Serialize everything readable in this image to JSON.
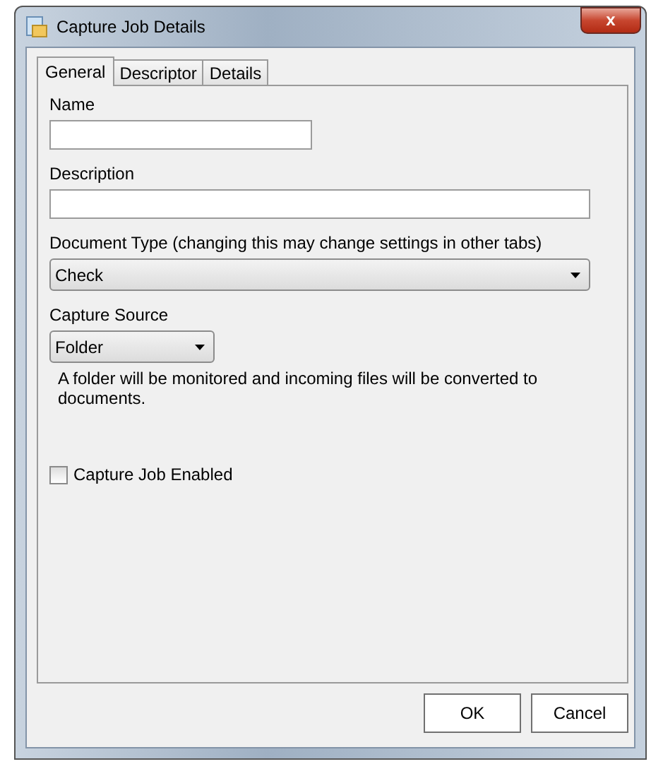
{
  "window": {
    "title": "Capture Job Details",
    "close": "x"
  },
  "tabs": [
    {
      "label": "General",
      "selected": true
    },
    {
      "label": "Descriptor",
      "selected": false
    },
    {
      "label": "Details",
      "selected": false
    }
  ],
  "fields": [
    {
      "kind": "text",
      "label": "Name"
    },
    {
      "kind": "text",
      "label": "Description"
    },
    {
      "kind": "select",
      "label": "Document Type (changing this may change settings in other tabs)",
      "value": "Check"
    },
    {
      "kind": "select",
      "label": "Capture Source",
      "value": "Folder",
      "note": "A folder will be monitored and incoming files will be converted to documents."
    }
  ],
  "checkbox": {
    "label": "Capture Job Enabled",
    "checked": false
  },
  "buttons": [
    "OK",
    "Cancel"
  ]
}
